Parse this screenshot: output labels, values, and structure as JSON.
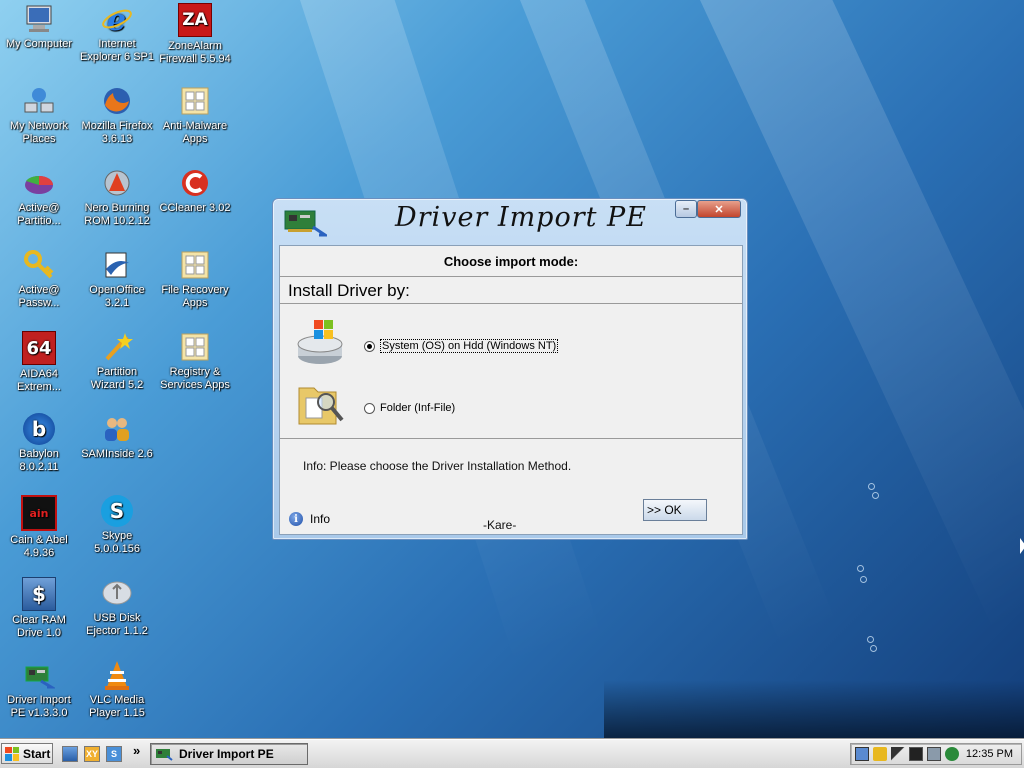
{
  "desktop": {
    "icons": [
      {
        "label": "My Computer",
        "icon": "computer-icon"
      },
      {
        "label": "Internet\nExplorer 6 SP1",
        "icon": "internet-explorer-icon"
      },
      {
        "label": "ZoneAlarm\nFirewall 5.5.94",
        "icon": "zonealarm-icon",
        "glyph": "ZA"
      },
      {
        "label": "My Network\nPlaces",
        "icon": "network-icon"
      },
      {
        "label": "Mozilla Firefox\n3.6.13",
        "icon": "firefox-icon"
      },
      {
        "label": "Anti-Malware\nApps",
        "icon": "folder-apps-icon"
      },
      {
        "label": "Active@\nPartitio...",
        "icon": "partition-pie-icon"
      },
      {
        "label": "Nero Burning\nROM 10.2.12",
        "icon": "nero-icon"
      },
      {
        "label": "CCleaner 3.02",
        "icon": "ccleaner-icon"
      },
      {
        "label": "Active@\nPassw...",
        "icon": "key-icon"
      },
      {
        "label": "OpenOffice\n3.2.1",
        "icon": "openoffice-icon"
      },
      {
        "label": "File Recovery\nApps",
        "icon": "folder-apps-icon"
      },
      {
        "label": "AIDA64\nExtrem...",
        "icon": "aida64-icon",
        "glyph": "64"
      },
      {
        "label": "Partition\nWizard 5.2",
        "icon": "wand-icon"
      },
      {
        "label": "Registry &\nServices Apps",
        "icon": "folder-apps-icon"
      },
      {
        "label": "Babylon\n8.0.2.11",
        "icon": "babylon-icon",
        "glyph": "b"
      },
      {
        "label": "SAMInside 2.6",
        "icon": "users-icon"
      },
      {
        "label": "Cain & Abel\n4.9.36",
        "icon": "cain-icon",
        "glyph": "ain"
      },
      {
        "label": "Skype\n5.0.0.156",
        "icon": "skype-icon",
        "glyph": "S"
      },
      {
        "label": "Clear RAM\nDrive 1.0",
        "icon": "dollar-icon",
        "glyph": "$"
      },
      {
        "label": "USB Disk\nEjector 1.1.2",
        "icon": "usb-icon"
      },
      {
        "label": "Driver Import\nPE v1.3.3.0",
        "icon": "driver-card-icon"
      },
      {
        "label": "VLC Media\nPlayer 1.15",
        "icon": "vlc-icon"
      }
    ]
  },
  "dialog": {
    "title": "Driver Import PE",
    "minimize_glyph": "–",
    "close_glyph": "✕",
    "choose_mode": "Choose import mode:",
    "install_by": "Install Driver by:",
    "option_system": "System (OS) on Hdd (Windows NT)",
    "option_folder": "Folder  (Inf-File)",
    "selected": "system",
    "info_message": "Info: Please choose the Driver Installation Method.",
    "ok_label": ">>  OK",
    "info_label": "Info",
    "author": "-Kare-"
  },
  "taskbar": {
    "start_label": "Start",
    "chevron": "»",
    "active_task": "Driver Import PE",
    "clock": "12:35 PM"
  }
}
